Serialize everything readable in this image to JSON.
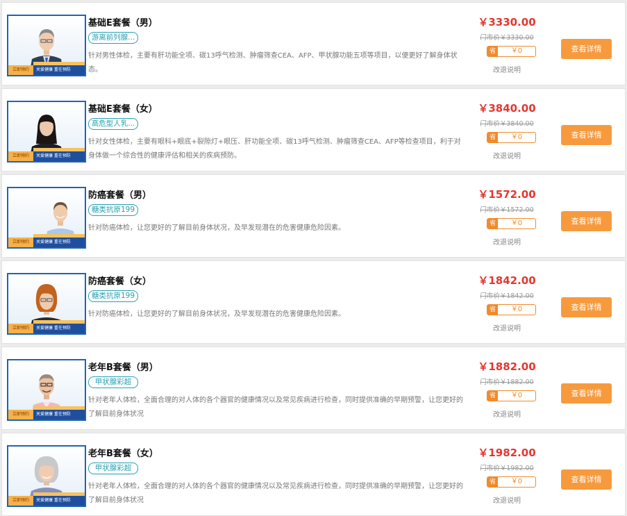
{
  "common": {
    "banner_left": "立即预约",
    "banner_text": "关爱健康 重在预防",
    "coupon_label": "省",
    "detail_label": "查看详情",
    "refund_label": "改退说明",
    "currency": "¥",
    "market_prefix": "门市价"
  },
  "colors": {
    "price": "#e5362f",
    "tag": "#28a0b0",
    "button": "#f79a3e",
    "banner": "#1f4e9c"
  },
  "packages": [
    {
      "title": "基础E套餐（男）",
      "tag": "游离前列腺...",
      "desc": "针对男性体检，主要有肝功能全项、碳13呼气检测、肿瘤筛查CEA、AFP、甲状腺功能五项等项目，以便更好了解身体状态。",
      "price": "￥3330.00",
      "market": "门市价￥3330.00",
      "coupon": "￥0",
      "person": "man-suit"
    },
    {
      "title": "基础E套餐（女）",
      "tag": "高危型人乳...",
      "desc": "针对女性体检，主要有眼科+眼底+裂隙灯+眼压、肝功能全项、碳13呼气检测、肿瘤筛查CEA、AFP等检查项目，利于对身体做一个综合性的健康评估和相关的疾病预防。",
      "price": "￥3840.00",
      "market": "门市价￥3840.00",
      "coupon": "￥0",
      "person": "woman-dark"
    },
    {
      "title": "防癌套餐（男）",
      "tag": "糖类抗原199",
      "desc": "针对防癌体检，让您更好的了解目前身体状况，及早发现潜在的危害健康危险因素。",
      "price": "￥1572.00",
      "market": "门市价￥1572.00",
      "coupon": "￥0",
      "person": "man-shirt"
    },
    {
      "title": "防癌套餐（女）",
      "tag": "糖类抗原199",
      "desc": "针对防癌体检，让您更好的了解目前身体状况，及早发现潜在的危害健康危险因素。",
      "price": "￥1842.00",
      "market": "门市价￥1842.00",
      "coupon": "￥0",
      "person": "woman-red"
    },
    {
      "title": "老年B套餐（男）",
      "tag": "甲状腺彩超",
      "desc": "针对老年人体检，全面合理的对人体的各个器官的健康情况以及常见疾病进行检查，同时提供准确的早期预警，让您更好的了解目前身体状况",
      "price": "￥1882.00",
      "market": "门市价￥1882.00",
      "coupon": "￥0",
      "person": "old-man"
    },
    {
      "title": "老年B套餐（女）",
      "tag": "甲状腺彩超",
      "desc": "针对老年人体检，全面合理的对人体的各个器官的健康情况以及常见疾病进行检查，同时提供准确的早期预警，让您更好的了解目前身体状况",
      "price": "￥1982.00",
      "market": "门市价￥1982.00",
      "coupon": "￥0",
      "person": "old-woman"
    }
  ]
}
